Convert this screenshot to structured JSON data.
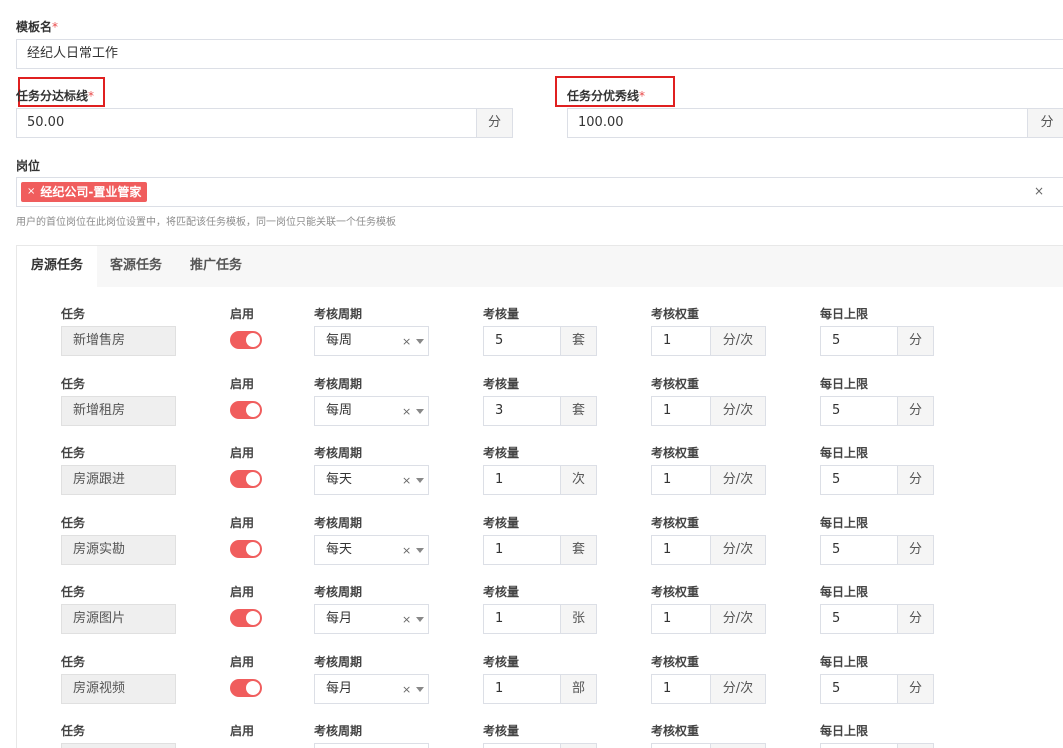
{
  "template_name": {
    "label": "模板名",
    "required": "*",
    "value": "经纪人日常工作"
  },
  "pass_line": {
    "label": "任务分达标线",
    "required": "*",
    "value": "50.00",
    "unit": "分"
  },
  "excellent_line": {
    "label": "任务分优秀线",
    "required": "*",
    "value": "100.00",
    "unit": "分"
  },
  "position": {
    "label": "岗位",
    "tag_remove": "×",
    "tag": "经纪公司-置业管家",
    "clear": "×",
    "hint": "用户的首位岗位在此岗位设置中，将匹配该任务模板，同一岗位只能关联一个任务模板"
  },
  "tabs": [
    {
      "label": "房源任务",
      "active": true
    },
    {
      "label": "客源任务",
      "active": false
    },
    {
      "label": "推广任务",
      "active": false
    }
  ],
  "columns": {
    "task": "任务",
    "enabled": "启用",
    "period": "考核周期",
    "amount": "考核量",
    "weight": "考核权重",
    "limit": "每日上限"
  },
  "select_clear": "×",
  "rows": [
    {
      "task": "新增售房",
      "enabled": true,
      "period": "每周",
      "amount": "5",
      "amount_unit": "套",
      "weight": "1",
      "weight_unit": "分/次",
      "limit": "5",
      "limit_unit": "分"
    },
    {
      "task": "新增租房",
      "enabled": true,
      "period": "每周",
      "amount": "3",
      "amount_unit": "套",
      "weight": "1",
      "weight_unit": "分/次",
      "limit": "5",
      "limit_unit": "分"
    },
    {
      "task": "房源跟进",
      "enabled": true,
      "period": "每天",
      "amount": "1",
      "amount_unit": "次",
      "weight": "1",
      "weight_unit": "分/次",
      "limit": "5",
      "limit_unit": "分"
    },
    {
      "task": "房源实勘",
      "enabled": true,
      "period": "每天",
      "amount": "1",
      "amount_unit": "套",
      "weight": "1",
      "weight_unit": "分/次",
      "limit": "5",
      "limit_unit": "分"
    },
    {
      "task": "房源图片",
      "enabled": true,
      "period": "每月",
      "amount": "1",
      "amount_unit": "张",
      "weight": "1",
      "weight_unit": "分/次",
      "limit": "5",
      "limit_unit": "分"
    },
    {
      "task": "房源视频",
      "enabled": true,
      "period": "每月",
      "amount": "1",
      "amount_unit": "部",
      "weight": "1",
      "weight_unit": "分/次",
      "limit": "5",
      "limit_unit": "分"
    },
    {
      "task": "",
      "enabled": true,
      "period": "",
      "amount": "",
      "amount_unit": "",
      "weight": "",
      "weight_unit": "",
      "limit": "",
      "limit_unit": ""
    }
  ]
}
